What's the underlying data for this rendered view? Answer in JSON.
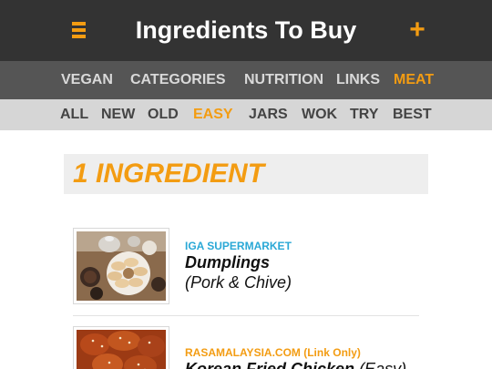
{
  "header": {
    "title": "Ingredients To Buy",
    "menu_icon": "hamburger-menu-icon",
    "add_label": "+",
    "accent_color": "#f39c12",
    "background": "#333333"
  },
  "nav_primary": {
    "items": [
      {
        "label": "VEGAN",
        "active": false
      },
      {
        "label": "CATEGORIES",
        "active": false
      },
      {
        "label": "NUTRITION",
        "active": false
      },
      {
        "label": "LINKS",
        "active": false
      },
      {
        "label": "MEAT",
        "active": true
      }
    ]
  },
  "nav_secondary": {
    "items": [
      {
        "label": "ALL",
        "active": false
      },
      {
        "label": "NEW",
        "active": false
      },
      {
        "label": "OLD",
        "active": false
      },
      {
        "label": "EASY",
        "active": true
      },
      {
        "label": "JARS",
        "active": false
      },
      {
        "label": "WOK",
        "active": false
      },
      {
        "label": "TRY",
        "active": false
      },
      {
        "label": "BEST",
        "active": false
      }
    ]
  },
  "section": {
    "title": "1 INGREDIENT"
  },
  "recipes": [
    {
      "source": "IGA SUPERMARKET",
      "source_color": "#2aa8d6",
      "name": "Dumplings",
      "detail": "(Pork & Chive)",
      "thumbnail": "dumplings-photo"
    },
    {
      "source": "RASAMALAYSIA.COM (Link Only)",
      "source_color": "#f39c12",
      "name": "Korean Fried Chicken",
      "difficulty": "(Easy)",
      "thumbnail": "fried-chicken-photo"
    }
  ]
}
